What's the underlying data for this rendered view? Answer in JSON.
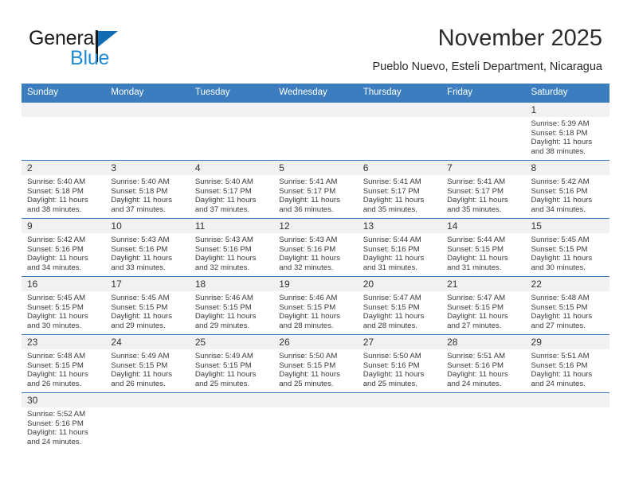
{
  "brand": {
    "name_top": "General",
    "name_bottom": "Blue",
    "accent_color": "#1e8ad6",
    "flag_color": "#0f6cb5"
  },
  "header": {
    "title": "November 2025",
    "subtitle": "Pueblo Nuevo, Esteli Department, Nicaragua",
    "header_bg": "#3b7dbe",
    "daynum_bg": "#f1f1f1"
  },
  "weekday_headers": [
    "Sunday",
    "Monday",
    "Tuesday",
    "Wednesday",
    "Thursday",
    "Friday",
    "Saturday"
  ],
  "labels": {
    "sunrise_prefix": "Sunrise:",
    "sunset_prefix": "Sunset:",
    "daylight_prefix": "Daylight:"
  },
  "weeks": [
    [
      {
        "day": "",
        "sunrise": "",
        "sunset": "",
        "daylight_line1": "",
        "daylight_line2": "",
        "empty": true
      },
      {
        "day": "",
        "sunrise": "",
        "sunset": "",
        "daylight_line1": "",
        "daylight_line2": "",
        "empty": true
      },
      {
        "day": "",
        "sunrise": "",
        "sunset": "",
        "daylight_line1": "",
        "daylight_line2": "",
        "empty": true
      },
      {
        "day": "",
        "sunrise": "",
        "sunset": "",
        "daylight_line1": "",
        "daylight_line2": "",
        "empty": true
      },
      {
        "day": "",
        "sunrise": "",
        "sunset": "",
        "daylight_line1": "",
        "daylight_line2": "",
        "empty": true
      },
      {
        "day": "",
        "sunrise": "",
        "sunset": "",
        "daylight_line1": "",
        "daylight_line2": "",
        "empty": true
      },
      {
        "day": "1",
        "sunrise": "Sunrise: 5:39 AM",
        "sunset": "Sunset: 5:18 PM",
        "daylight_line1": "Daylight: 11 hours",
        "daylight_line2": "and 38 minutes.",
        "empty": false
      }
    ],
    [
      {
        "day": "2",
        "sunrise": "Sunrise: 5:40 AM",
        "sunset": "Sunset: 5:18 PM",
        "daylight_line1": "Daylight: 11 hours",
        "daylight_line2": "and 38 minutes.",
        "empty": false
      },
      {
        "day": "3",
        "sunrise": "Sunrise: 5:40 AM",
        "sunset": "Sunset: 5:18 PM",
        "daylight_line1": "Daylight: 11 hours",
        "daylight_line2": "and 37 minutes.",
        "empty": false
      },
      {
        "day": "4",
        "sunrise": "Sunrise: 5:40 AM",
        "sunset": "Sunset: 5:17 PM",
        "daylight_line1": "Daylight: 11 hours",
        "daylight_line2": "and 37 minutes.",
        "empty": false
      },
      {
        "day": "5",
        "sunrise": "Sunrise: 5:41 AM",
        "sunset": "Sunset: 5:17 PM",
        "daylight_line1": "Daylight: 11 hours",
        "daylight_line2": "and 36 minutes.",
        "empty": false
      },
      {
        "day": "6",
        "sunrise": "Sunrise: 5:41 AM",
        "sunset": "Sunset: 5:17 PM",
        "daylight_line1": "Daylight: 11 hours",
        "daylight_line2": "and 35 minutes.",
        "empty": false
      },
      {
        "day": "7",
        "sunrise": "Sunrise: 5:41 AM",
        "sunset": "Sunset: 5:17 PM",
        "daylight_line1": "Daylight: 11 hours",
        "daylight_line2": "and 35 minutes.",
        "empty": false
      },
      {
        "day": "8",
        "sunrise": "Sunrise: 5:42 AM",
        "sunset": "Sunset: 5:16 PM",
        "daylight_line1": "Daylight: 11 hours",
        "daylight_line2": "and 34 minutes.",
        "empty": false
      }
    ],
    [
      {
        "day": "9",
        "sunrise": "Sunrise: 5:42 AM",
        "sunset": "Sunset: 5:16 PM",
        "daylight_line1": "Daylight: 11 hours",
        "daylight_line2": "and 34 minutes.",
        "empty": false
      },
      {
        "day": "10",
        "sunrise": "Sunrise: 5:43 AM",
        "sunset": "Sunset: 5:16 PM",
        "daylight_line1": "Daylight: 11 hours",
        "daylight_line2": "and 33 minutes.",
        "empty": false
      },
      {
        "day": "11",
        "sunrise": "Sunrise: 5:43 AM",
        "sunset": "Sunset: 5:16 PM",
        "daylight_line1": "Daylight: 11 hours",
        "daylight_line2": "and 32 minutes.",
        "empty": false
      },
      {
        "day": "12",
        "sunrise": "Sunrise: 5:43 AM",
        "sunset": "Sunset: 5:16 PM",
        "daylight_line1": "Daylight: 11 hours",
        "daylight_line2": "and 32 minutes.",
        "empty": false
      },
      {
        "day": "13",
        "sunrise": "Sunrise: 5:44 AM",
        "sunset": "Sunset: 5:16 PM",
        "daylight_line1": "Daylight: 11 hours",
        "daylight_line2": "and 31 minutes.",
        "empty": false
      },
      {
        "day": "14",
        "sunrise": "Sunrise: 5:44 AM",
        "sunset": "Sunset: 5:15 PM",
        "daylight_line1": "Daylight: 11 hours",
        "daylight_line2": "and 31 minutes.",
        "empty": false
      },
      {
        "day": "15",
        "sunrise": "Sunrise: 5:45 AM",
        "sunset": "Sunset: 5:15 PM",
        "daylight_line1": "Daylight: 11 hours",
        "daylight_line2": "and 30 minutes.",
        "empty": false
      }
    ],
    [
      {
        "day": "16",
        "sunrise": "Sunrise: 5:45 AM",
        "sunset": "Sunset: 5:15 PM",
        "daylight_line1": "Daylight: 11 hours",
        "daylight_line2": "and 30 minutes.",
        "empty": false
      },
      {
        "day": "17",
        "sunrise": "Sunrise: 5:45 AM",
        "sunset": "Sunset: 5:15 PM",
        "daylight_line1": "Daylight: 11 hours",
        "daylight_line2": "and 29 minutes.",
        "empty": false
      },
      {
        "day": "18",
        "sunrise": "Sunrise: 5:46 AM",
        "sunset": "Sunset: 5:15 PM",
        "daylight_line1": "Daylight: 11 hours",
        "daylight_line2": "and 29 minutes.",
        "empty": false
      },
      {
        "day": "19",
        "sunrise": "Sunrise: 5:46 AM",
        "sunset": "Sunset: 5:15 PM",
        "daylight_line1": "Daylight: 11 hours",
        "daylight_line2": "and 28 minutes.",
        "empty": false
      },
      {
        "day": "20",
        "sunrise": "Sunrise: 5:47 AM",
        "sunset": "Sunset: 5:15 PM",
        "daylight_line1": "Daylight: 11 hours",
        "daylight_line2": "and 28 minutes.",
        "empty": false
      },
      {
        "day": "21",
        "sunrise": "Sunrise: 5:47 AM",
        "sunset": "Sunset: 5:15 PM",
        "daylight_line1": "Daylight: 11 hours",
        "daylight_line2": "and 27 minutes.",
        "empty": false
      },
      {
        "day": "22",
        "sunrise": "Sunrise: 5:48 AM",
        "sunset": "Sunset: 5:15 PM",
        "daylight_line1": "Daylight: 11 hours",
        "daylight_line2": "and 27 minutes.",
        "empty": false
      }
    ],
    [
      {
        "day": "23",
        "sunrise": "Sunrise: 5:48 AM",
        "sunset": "Sunset: 5:15 PM",
        "daylight_line1": "Daylight: 11 hours",
        "daylight_line2": "and 26 minutes.",
        "empty": false
      },
      {
        "day": "24",
        "sunrise": "Sunrise: 5:49 AM",
        "sunset": "Sunset: 5:15 PM",
        "daylight_line1": "Daylight: 11 hours",
        "daylight_line2": "and 26 minutes.",
        "empty": false
      },
      {
        "day": "25",
        "sunrise": "Sunrise: 5:49 AM",
        "sunset": "Sunset: 5:15 PM",
        "daylight_line1": "Daylight: 11 hours",
        "daylight_line2": "and 25 minutes.",
        "empty": false
      },
      {
        "day": "26",
        "sunrise": "Sunrise: 5:50 AM",
        "sunset": "Sunset: 5:15 PM",
        "daylight_line1": "Daylight: 11 hours",
        "daylight_line2": "and 25 minutes.",
        "empty": false
      },
      {
        "day": "27",
        "sunrise": "Sunrise: 5:50 AM",
        "sunset": "Sunset: 5:16 PM",
        "daylight_line1": "Daylight: 11 hours",
        "daylight_line2": "and 25 minutes.",
        "empty": false
      },
      {
        "day": "28",
        "sunrise": "Sunrise: 5:51 AM",
        "sunset": "Sunset: 5:16 PM",
        "daylight_line1": "Daylight: 11 hours",
        "daylight_line2": "and 24 minutes.",
        "empty": false
      },
      {
        "day": "29",
        "sunrise": "Sunrise: 5:51 AM",
        "sunset": "Sunset: 5:16 PM",
        "daylight_line1": "Daylight: 11 hours",
        "daylight_line2": "and 24 minutes.",
        "empty": false
      }
    ],
    [
      {
        "day": "30",
        "sunrise": "Sunrise: 5:52 AM",
        "sunset": "Sunset: 5:16 PM",
        "daylight_line1": "Daylight: 11 hours",
        "daylight_line2": "and 24 minutes.",
        "empty": false
      },
      {
        "day": "",
        "sunrise": "",
        "sunset": "",
        "daylight_line1": "",
        "daylight_line2": "",
        "empty": true
      },
      {
        "day": "",
        "sunrise": "",
        "sunset": "",
        "daylight_line1": "",
        "daylight_line2": "",
        "empty": true
      },
      {
        "day": "",
        "sunrise": "",
        "sunset": "",
        "daylight_line1": "",
        "daylight_line2": "",
        "empty": true
      },
      {
        "day": "",
        "sunrise": "",
        "sunset": "",
        "daylight_line1": "",
        "daylight_line2": "",
        "empty": true
      },
      {
        "day": "",
        "sunrise": "",
        "sunset": "",
        "daylight_line1": "",
        "daylight_line2": "",
        "empty": true
      },
      {
        "day": "",
        "sunrise": "",
        "sunset": "",
        "daylight_line1": "",
        "daylight_line2": "",
        "empty": true
      }
    ]
  ]
}
